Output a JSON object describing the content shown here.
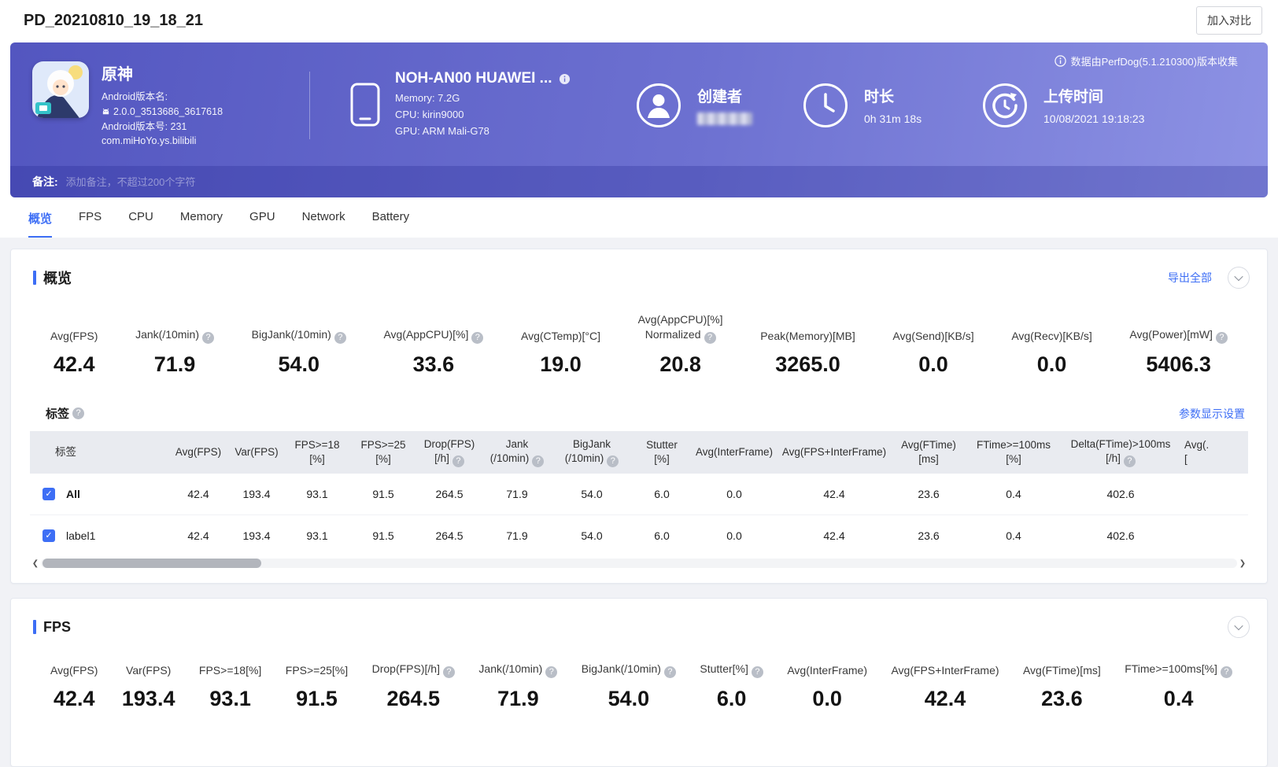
{
  "topbar": {
    "title": "PD_20210810_19_18_21",
    "compare_button": "加入对比"
  },
  "banner": {
    "collect_info": "数据由PerfDog(5.1.210300)版本收集",
    "app": {
      "name": "原神",
      "version_name_label": "Android版本名:",
      "version_name_value": "2.0.0_3513686_3617618",
      "version_code_line": "Android版本号: 231",
      "package_name": "com.miHoYo.ys.bilibili"
    },
    "device": {
      "name": "NOH-AN00 HUAWEI ...",
      "memory_line": "Memory: 7.2G",
      "cpu_line": "CPU: kirin9000",
      "gpu_line": "GPU: ARM Mali-G78"
    },
    "creator": {
      "label": "创建者"
    },
    "duration": {
      "label": "时长",
      "value": "0h 31m 18s"
    },
    "upload": {
      "label": "上传时间",
      "value": "10/08/2021 19:18:23"
    },
    "note": {
      "label": "备注:",
      "placeholder": "添加备注，不超过200个字符"
    }
  },
  "tabs": [
    {
      "label": "概览"
    },
    {
      "label": "FPS"
    },
    {
      "label": "CPU"
    },
    {
      "label": "Memory"
    },
    {
      "label": "GPU"
    },
    {
      "label": "Network"
    },
    {
      "label": "Battery"
    }
  ],
  "overview": {
    "title": "概览",
    "export_all": "导出全部",
    "metrics": [
      {
        "label": "Avg(FPS)",
        "label2": "",
        "value": "42.4"
      },
      {
        "label": "Jank(/10min)",
        "label2": "",
        "value": "71.9"
      },
      {
        "label": "BigJank(/10min)",
        "label2": "",
        "value": "54.0"
      },
      {
        "label": "Avg(AppCPU)[%]",
        "label2": "",
        "value": "33.6"
      },
      {
        "label": "Avg(CTemp)[°C]",
        "label2": "",
        "value": "19.0"
      },
      {
        "label": "Avg(AppCPU)[%]",
        "label2": "Normalized",
        "value": "20.8"
      },
      {
        "label": "Peak(Memory)[MB]",
        "label2": "",
        "value": "3265.0"
      },
      {
        "label": "Avg(Send)[KB/s]",
        "label2": "",
        "value": "0.0"
      },
      {
        "label": "Avg(Recv)[KB/s]",
        "label2": "",
        "value": "0.0"
      },
      {
        "label": "Avg(Power)[mW]",
        "label2": "",
        "value": "5406.3"
      }
    ],
    "labels": {
      "title": "标签",
      "settings_link": "参数显示设置",
      "table": {
        "headers": [
          {
            "l1": "标签",
            "l2": ""
          },
          {
            "l1": "Avg(FPS)",
            "l2": ""
          },
          {
            "l1": "Var(FPS)",
            "l2": ""
          },
          {
            "l1": "FPS>=18",
            "l2": "[%]"
          },
          {
            "l1": "FPS>=25",
            "l2": "[%]"
          },
          {
            "l1": "Drop(FPS)",
            "l2": "[/h]"
          },
          {
            "l1": "Jank",
            "l2": "(/10min)"
          },
          {
            "l1": "BigJank",
            "l2": "(/10min)"
          },
          {
            "l1": "Stutter",
            "l2": "[%]"
          },
          {
            "l1": "Avg(InterFrame)",
            "l2": ""
          },
          {
            "l1": "Avg(FPS+InterFrame)",
            "l2": ""
          },
          {
            "l1": "Avg(FTime)",
            "l2": "[ms]"
          },
          {
            "l1": "FTime>=100ms",
            "l2": "[%]"
          },
          {
            "l1": "Delta(FTime)>100ms",
            "l2": "[/h]"
          },
          {
            "l1": "Avg(.",
            "l2": "["
          }
        ],
        "rows": [
          {
            "label": "All",
            "values": [
              "42.4",
              "193.4",
              "93.1",
              "91.5",
              "264.5",
              "71.9",
              "54.0",
              "6.0",
              "0.0",
              "42.4",
              "23.6",
              "0.4",
              "402.6"
            ]
          },
          {
            "label": "label1",
            "values": [
              "42.4",
              "193.4",
              "93.1",
              "91.5",
              "264.5",
              "71.9",
              "54.0",
              "6.0",
              "0.0",
              "42.4",
              "23.6",
              "0.4",
              "402.6"
            ]
          }
        ]
      }
    }
  },
  "fps": {
    "title": "FPS",
    "metrics": [
      {
        "label": "Avg(FPS)",
        "value": "42.4"
      },
      {
        "label": "Var(FPS)",
        "value": "193.4"
      },
      {
        "label": "FPS>=18[%]",
        "value": "93.1"
      },
      {
        "label": "FPS>=25[%]",
        "value": "91.5"
      },
      {
        "label": "Drop(FPS)[/h]",
        "value": "264.5"
      },
      {
        "label": "Jank(/10min)",
        "value": "71.9"
      },
      {
        "label": "BigJank(/10min)",
        "value": "54.0"
      },
      {
        "label": "Stutter[%]",
        "value": "6.0"
      },
      {
        "label": "Avg(InterFrame)",
        "value": "0.0"
      },
      {
        "label": "Avg(FPS+InterFrame)",
        "value": "42.4"
      },
      {
        "label": "Avg(FTime)[ms]",
        "value": "23.6"
      },
      {
        "label": "FTime>=100ms[%]",
        "value": "0.4"
      }
    ]
  }
}
